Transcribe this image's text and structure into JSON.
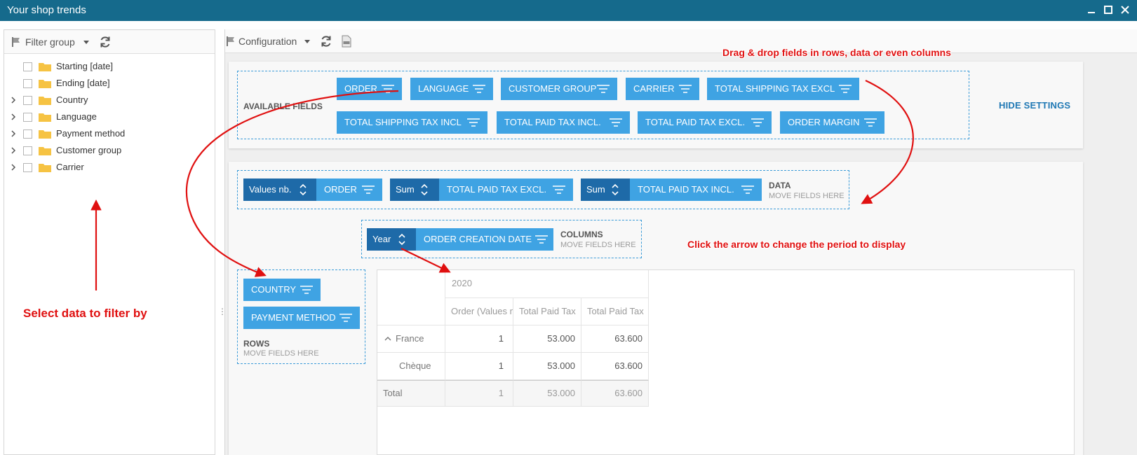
{
  "window": {
    "title": "Your shop trends"
  },
  "left_panel": {
    "toolbar_label": "Filter group",
    "items": [
      {
        "label": "Starting [date]",
        "expandable": false
      },
      {
        "label": "Ending [date]",
        "expandable": false
      },
      {
        "label": "Country",
        "expandable": true
      },
      {
        "label": "Language",
        "expandable": true
      },
      {
        "label": "Payment method",
        "expandable": true
      },
      {
        "label": "Customer group",
        "expandable": true
      },
      {
        "label": "Carrier",
        "expandable": true
      }
    ]
  },
  "right_panel": {
    "toolbar_label": "Configuration",
    "available_fields": {
      "label": "AVAILABLE FIELDS",
      "fields": [
        "ORDER",
        "LANGUAGE",
        "CUSTOMER GROUP",
        "CARRIER",
        "TOTAL SHIPPING TAX EXCL",
        "TOTAL SHIPPING TAX INCL",
        "TOTAL PAID TAX INCL.",
        "TOTAL PAID TAX EXCL.",
        "ORDER MARGIN"
      ]
    },
    "hide_settings": "HIDE SETTINGS",
    "data_area": {
      "label": "DATA",
      "hint": "MOVE FIELDS HERE",
      "fields": [
        {
          "agg": "Values nb.",
          "name": "ORDER"
        },
        {
          "agg": "Sum",
          "name": "TOTAL PAID TAX EXCL."
        },
        {
          "agg": "Sum",
          "name": "TOTAL PAID TAX INCL."
        }
      ]
    },
    "columns_area": {
      "label": "COLUMNS",
      "hint": "MOVE FIELDS HERE",
      "fields": [
        {
          "agg": "Year",
          "name": "ORDER CREATION DATE"
        }
      ]
    },
    "rows_area": {
      "label": "ROWS",
      "hint": "MOVE FIELDS HERE",
      "fields": [
        "COUNTRY",
        "PAYMENT METHOD"
      ]
    },
    "grid": {
      "year": "2020",
      "headers": [
        "Order (Values nb.)",
        "Total Paid Tax",
        "Total Paid Tax"
      ],
      "rows": [
        {
          "label": "France",
          "values": [
            "1",
            "53.000",
            "63.600"
          ]
        },
        {
          "label": "Chèque",
          "values": [
            "1",
            "53.000",
            "63.600"
          ]
        },
        {
          "label": "Total",
          "values": [
            "1",
            "53.000",
            "63.600"
          ]
        }
      ]
    }
  },
  "annotations": {
    "drag_drop": "Drag & drop fields in rows, data or even  columns",
    "period": "Click the arrow to change the period to display",
    "filter": "Select data to filter by"
  },
  "colors": {
    "titlebar": "#156a8c",
    "field": "#3fa3e3",
    "aggregate": "#1e6aa8",
    "annotation": "#e01010"
  }
}
